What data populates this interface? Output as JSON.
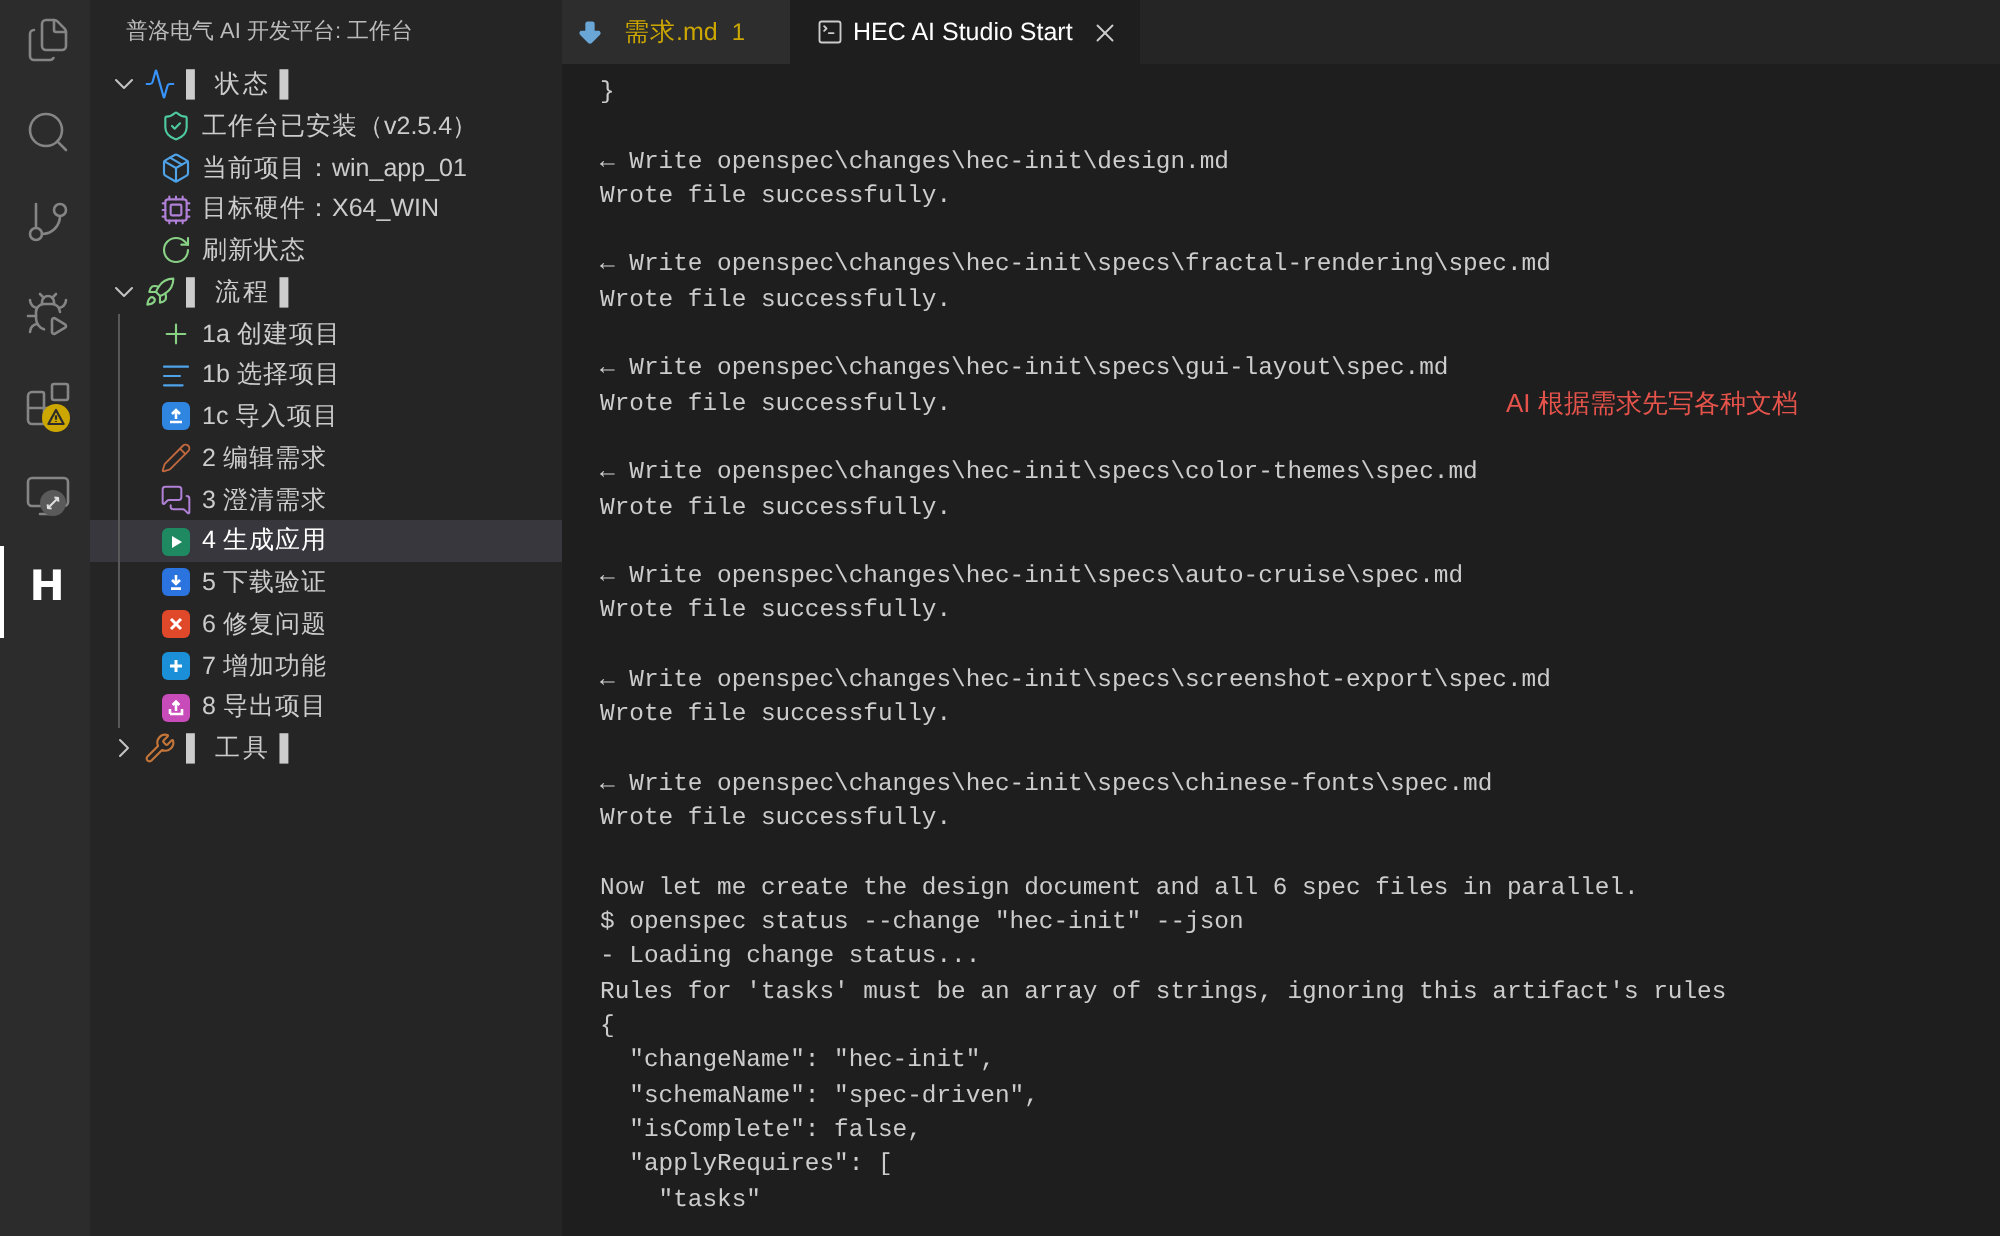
{
  "activity_bar": {
    "items": [
      {
        "selected": false,
        "alert": false,
        "disconnected": false
      },
      {
        "selected": false,
        "alert": false,
        "disconnected": false
      },
      {
        "selected": false,
        "alert": false,
        "disconnected": false
      },
      {
        "selected": false,
        "alert": false,
        "disconnected": false
      },
      {
        "selected": false,
        "alert": true,
        "disconnected": false
      },
      {
        "selected": false,
        "alert": false,
        "disconnected": true
      },
      {
        "selected": true,
        "alert": false,
        "disconnected": false,
        "label": "H"
      }
    ]
  },
  "sidebar": {
    "title": "普洛电气 AI 开发平台: 工作台",
    "sections": [
      {
        "label": "▌ 状态 ▌",
        "expanded": true,
        "children": [
          {
            "label": "工作台已安装（v2.5.4）",
            "selected": false
          },
          {
            "label": "当前项目：win_app_01",
            "selected": false
          },
          {
            "label": "目标硬件：X64_WIN",
            "selected": false
          },
          {
            "label": "刷新状态",
            "selected": false
          }
        ]
      },
      {
        "label": "▌ 流程 ▌",
        "expanded": true,
        "children": [
          {
            "label": "1a 创建项目",
            "selected": false
          },
          {
            "label": "1b 选择项目",
            "selected": false
          },
          {
            "label": "1c 导入项目",
            "selected": false
          },
          {
            "label": "2 编辑需求",
            "selected": false
          },
          {
            "label": "3 澄清需求",
            "selected": false
          },
          {
            "label": "4 生成应用",
            "selected": true
          },
          {
            "label": "5 下载验证",
            "selected": false
          },
          {
            "label": "6 修复问题",
            "selected": false
          },
          {
            "label": "7 增加功能",
            "selected": false
          },
          {
            "label": "8 导出项目",
            "selected": false
          }
        ]
      },
      {
        "label": "▌ 工具 ▌",
        "expanded": false
      }
    ]
  },
  "tabs": [
    {
      "label": "需求.md",
      "count": "1",
      "warning": true,
      "selected": false
    },
    {
      "label": "HEC AI Studio Start",
      "warning": false,
      "selected": true
    }
  ],
  "terminal": {
    "blocks": [
      [
        "}"
      ],
      [
        "← Write openspec\\changes\\hec-init\\design.md",
        "Wrote file successfully."
      ],
      [
        "← Write openspec\\changes\\hec-init\\specs\\fractal-rendering\\spec.md",
        "Wrote file successfully."
      ],
      [
        "← Write openspec\\changes\\hec-init\\specs\\gui-layout\\spec.md",
        "Wrote file successfully."
      ],
      [
        "← Write openspec\\changes\\hec-init\\specs\\color-themes\\spec.md",
        "Wrote file successfully."
      ],
      [
        "← Write openspec\\changes\\hec-init\\specs\\auto-cruise\\spec.md",
        "Wrote file successfully."
      ],
      [
        "← Write openspec\\changes\\hec-init\\specs\\screenshot-export\\spec.md",
        "Wrote file successfully."
      ],
      [
        "← Write openspec\\changes\\hec-init\\specs\\chinese-fonts\\spec.md",
        "Wrote file successfully."
      ],
      [
        "Now let me create the design document and all 6 spec files in parallel.",
        "$ openspec status --change \"hec-init\" --json",
        "- Loading change status...",
        "Rules for 'tasks' must be an array of strings, ignoring this artifact's rules",
        "{",
        "  \"changeName\": \"hec-init\",",
        "  \"schemaName\": \"spec-driven\",",
        "  \"isComplete\": false,",
        "  \"applyRequires\": [",
        "    \"tasks\""
      ]
    ]
  },
  "annotation": {
    "text": "AI 根据需求先写各种文档"
  }
}
